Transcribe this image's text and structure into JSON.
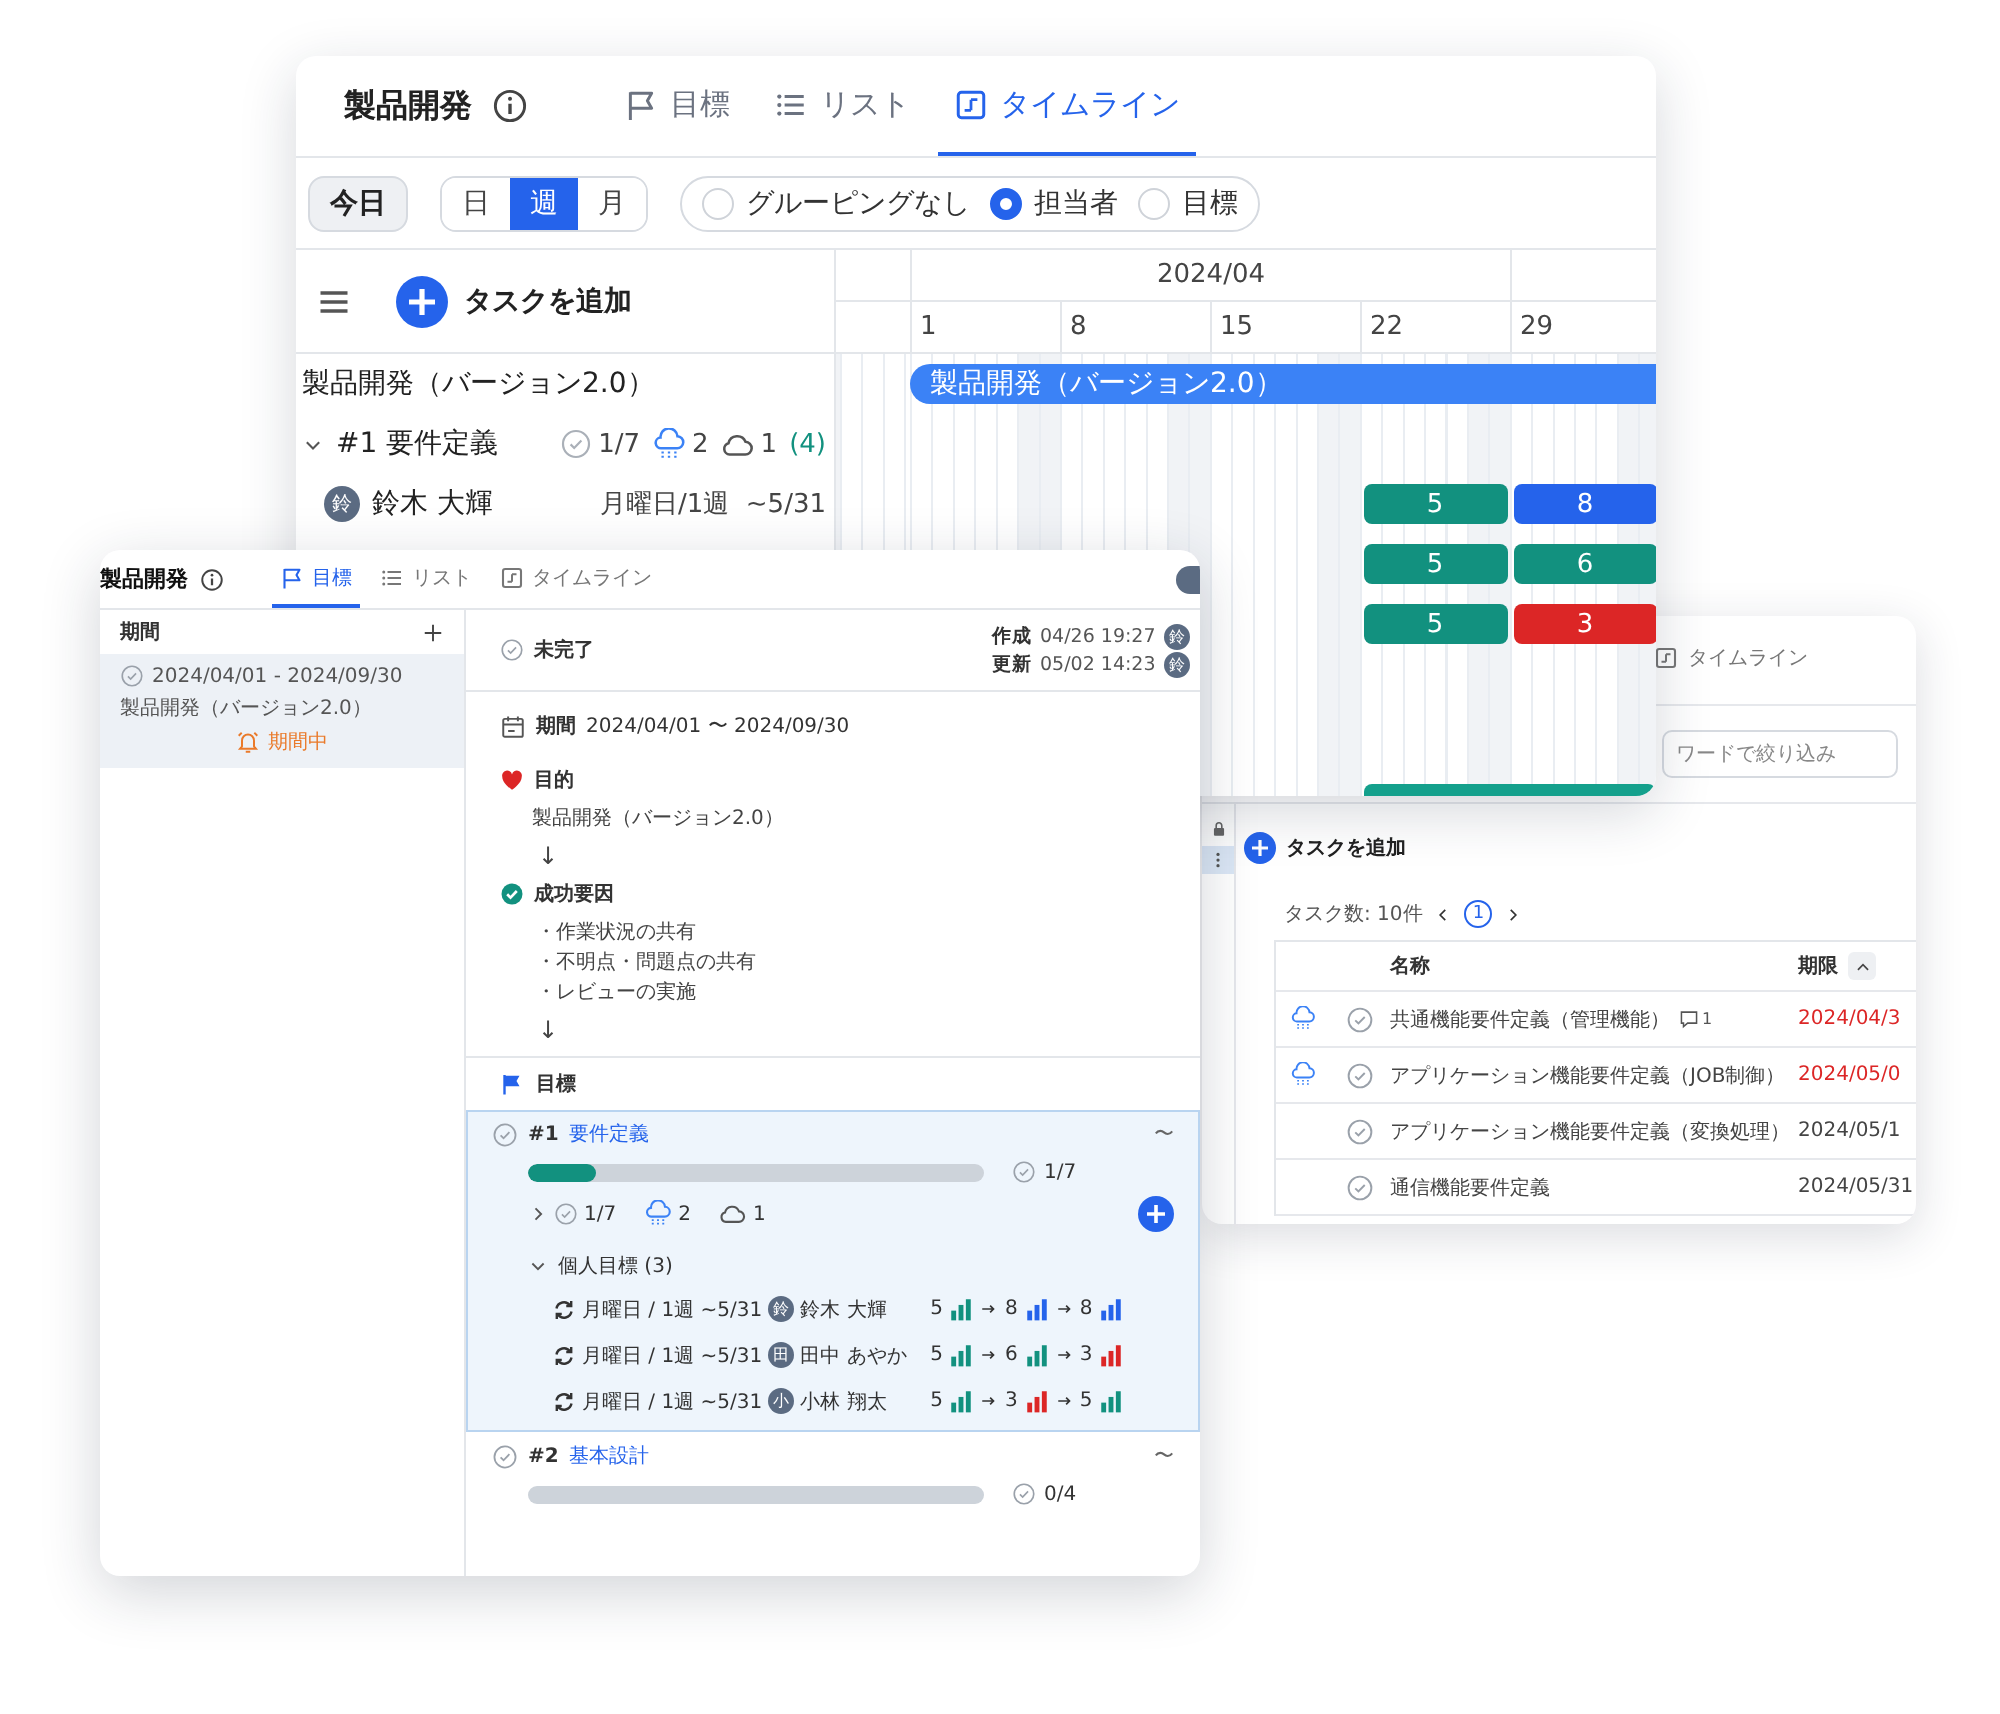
{
  "timeline_window": {
    "title": "製品開発",
    "tabs": [
      {
        "kind": "goals",
        "label": "目標",
        "selected": false
      },
      {
        "kind": "list",
        "label": "リスト",
        "selected": false
      },
      {
        "kind": "timeline",
        "label": "タイムライン",
        "selected": true
      }
    ],
    "today_button": "今日",
    "scale": [
      {
        "label": "日",
        "selected": false
      },
      {
        "label": "週",
        "selected": true
      },
      {
        "label": "月",
        "selected": false
      }
    ],
    "grouping": [
      {
        "label": "グルーピングなし",
        "selected": false
      },
      {
        "label": "担当者",
        "selected": true
      },
      {
        "label": "目標",
        "selected": false
      }
    ],
    "add_task": "タスクを追加",
    "month": "2024/04",
    "weeks": [
      "1",
      "8",
      "15",
      "22",
      "29"
    ],
    "project": {
      "name": "製品開発（バージョン2.0）",
      "bar": "製品開発（バージョン2.0）"
    },
    "goal": {
      "name": "#1 要件定義",
      "expanded": true,
      "done": "1/7",
      "rain": "2",
      "cloud": "1",
      "count": "(4)"
    },
    "member": {
      "avatar": "鈴",
      "name": "鈴木 大輝",
      "schedule": "月曜日/1週  ~5/31"
    },
    "bar_rows": [
      [
        null,
        null,
        null,
        {
          "value": "5",
          "color": "#12917f"
        },
        {
          "value": "8",
          "color": "#2563eb"
        }
      ],
      [
        null,
        null,
        null,
        {
          "value": "5",
          "color": "#12917f"
        },
        {
          "value": "6",
          "color": "#12917f"
        }
      ],
      [
        null,
        null,
        null,
        {
          "value": "5",
          "color": "#12917f"
        },
        {
          "value": "3",
          "color": "#dc2626"
        }
      ]
    ]
  },
  "goal_window": {
    "title": "製品開発",
    "tabs": [
      {
        "kind": "goals",
        "label": "目標",
        "selected": true
      },
      {
        "kind": "list",
        "label": "リスト",
        "selected": false
      },
      {
        "kind": "timeline",
        "label": "タイムライン",
        "selected": false
      }
    ],
    "sidebar": {
      "header": "期間",
      "items": [
        {
          "range": "2024/04/01 - 2024/09/30",
          "name": "製品開発（バージョン2.0）",
          "status": "期間中",
          "selected": true
        }
      ]
    },
    "status": "未完了",
    "meta": [
      {
        "label": "作成",
        "time": "04/26 19:27",
        "avatar": "鈴"
      },
      {
        "label": "更新",
        "time": "05/02 14:23",
        "avatar": "鈴"
      }
    ],
    "period": {
      "label": "期間",
      "value": "2024/04/01 〜 2024/09/30"
    },
    "purpose": {
      "label": "目的",
      "text": "製品開発（バージョン2.0）",
      "arrow": "↓"
    },
    "success": {
      "label": "成功要因",
      "items": [
        "・作業状況の共有",
        "・不明点・問題点の共有",
        "・レビューの実施"
      ],
      "arrow": "↓"
    },
    "goals_heading": "目標",
    "goals": [
      {
        "number": "#1",
        "name": "要件定義",
        "due": "〜",
        "selected": true,
        "level": 0.15,
        "done": "1/7",
        "summary": {
          "expanded": false,
          "done": "1/7",
          "rain": "2",
          "cloud": "1"
        },
        "personal": {
          "label": "個人目標 (3)",
          "expanded": true,
          "rows": [
            {
              "schedule": "月曜日 / 1週 ~5/31",
              "avatar": "鈴",
              "name": "鈴木 大輝",
              "levels": [
                {
                  "value": "5",
                  "color": "#12917f"
                },
                {
                  "value": "8",
                  "color": "#2563eb"
                },
                {
                  "value": "8",
                  "color": "#2563eb"
                }
              ]
            },
            {
              "schedule": "月曜日 / 1週 ~5/31",
              "avatar": "田",
              "name": "田中 あやか",
              "levels": [
                {
                  "value": "5",
                  "color": "#12917f"
                },
                {
                  "value": "6",
                  "color": "#12917f"
                },
                {
                  "value": "3",
                  "color": "#dc2626"
                }
              ]
            },
            {
              "schedule": "月曜日 / 1週 ~5/31",
              "avatar": "小",
              "name": "小林 翔太",
              "levels": [
                {
                  "value": "5",
                  "color": "#12917f"
                },
                {
                  "value": "3",
                  "color": "#dc2626"
                },
                {
                  "value": "5",
                  "color": "#12917f"
                }
              ]
            }
          ]
        }
      },
      {
        "number": "#2",
        "name": "基本設計",
        "due": "〜",
        "selected": false,
        "level": 0,
        "done": "0/4"
      }
    ]
  },
  "list_window": {
    "tab": {
      "label": "タイムライン",
      "selected": false
    },
    "search": {
      "placeholder": "ワードで絞り込み"
    },
    "add_task": "タスクを追加",
    "count": "タスク数: 10件",
    "page": "1",
    "columns": [
      "名称",
      "期限"
    ],
    "rows": [
      {
        "rain": true,
        "name": "共通機能要件定義（管理機能）",
        "comments": "1",
        "deadline": "2024/04/3",
        "overdue": true
      },
      {
        "rain": true,
        "name": "アプリケーション機能要件定義（JOB制御）",
        "deadline": "2024/05/0",
        "overdue": true
      },
      {
        "rain": false,
        "name": "アプリケーション機能要件定義（変換処理）",
        "deadline": "2024/05/1",
        "overdue": false
      },
      {
        "rain": false,
        "name": "通信機能要件定義",
        "deadline": "2024/05/31",
        "overdue": false
      }
    ]
  }
}
